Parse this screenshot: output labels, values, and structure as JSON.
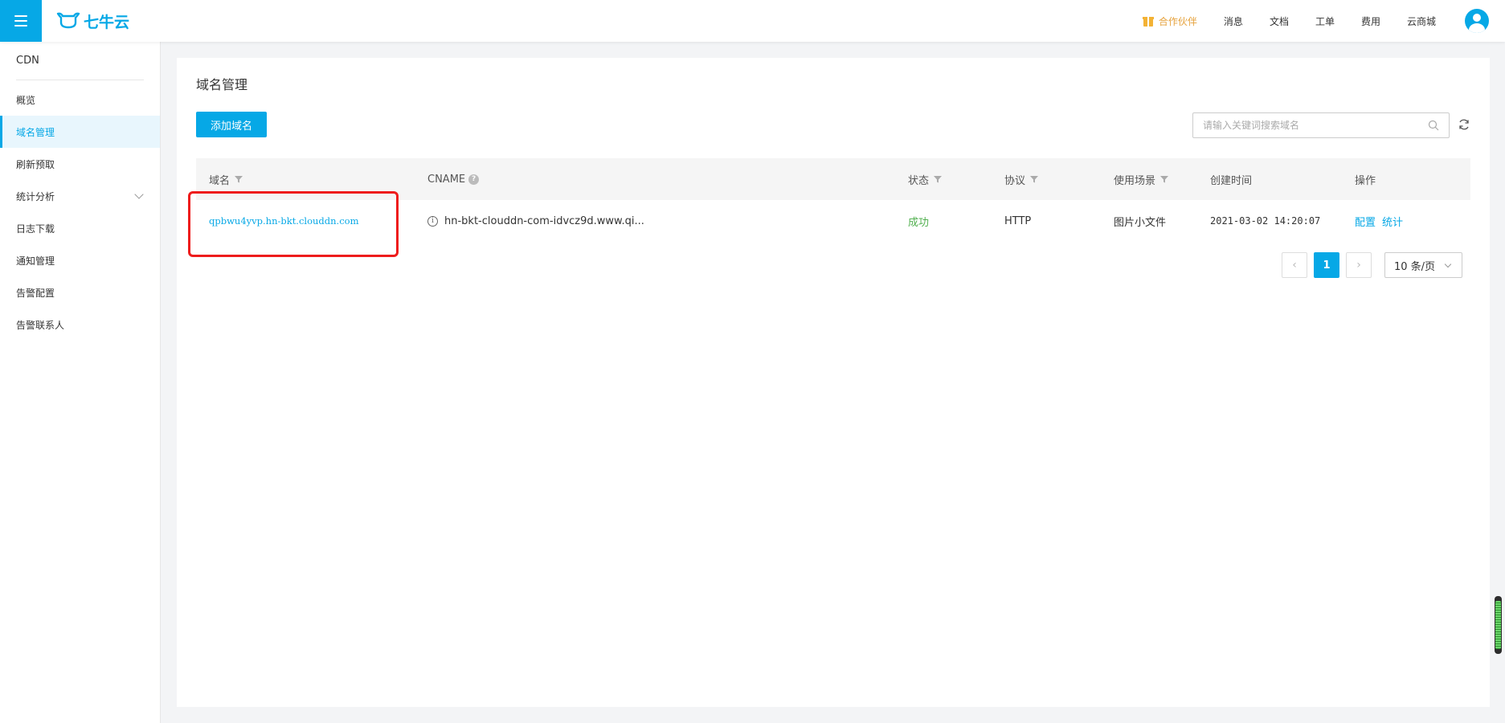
{
  "header": {
    "logo_text": "七牛云",
    "nav": {
      "partner": "合作伙伴",
      "messages": "消息",
      "docs": "文档",
      "tickets": "工单",
      "billing": "费用",
      "marketplace": "云商城"
    },
    "accent_color": "#06a8e6",
    "partner_color": "#e6a23c"
  },
  "sidebar": {
    "title": "CDN",
    "items": [
      {
        "label": "概览"
      },
      {
        "label": "域名管理",
        "active": true
      },
      {
        "label": "刷新预取"
      },
      {
        "label": "统计分析",
        "expandable": true
      },
      {
        "label": "日志下载"
      },
      {
        "label": "通知管理"
      },
      {
        "label": "告警配置"
      },
      {
        "label": "告警联系人"
      }
    ]
  },
  "main": {
    "title": "域名管理",
    "add_button": "添加域名",
    "search_placeholder": "请输入关键词搜索域名",
    "table": {
      "headers": {
        "domain": "域名",
        "cname": "CNAME",
        "status": "状态",
        "protocol": "协议",
        "scenario": "使用场景",
        "created": "创建时间",
        "actions": "操作"
      },
      "rows": [
        {
          "domain": "qpbwu4yvp.hn-bkt.clouddn.com",
          "cname": "hn-bkt-clouddn-com-idvcz9d.www.qi...",
          "status": "成功",
          "protocol": "HTTP",
          "scenario": "图片小文件",
          "created": "2021-03-02 14:20:07",
          "action_config": "配置",
          "action_stats": "统计"
        }
      ]
    },
    "pagination": {
      "current_page": "1",
      "page_size": "10 条/页"
    },
    "success_color": "#52b050",
    "highlight_color": "#ee1c1c"
  }
}
